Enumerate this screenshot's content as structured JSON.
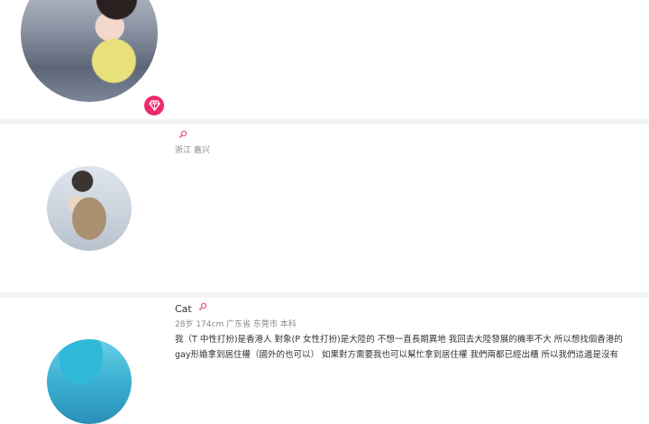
{
  "users": [
    {
      "name": "",
      "gender_icon": "female-icon",
      "badge_icon": "diamond-icon",
      "accent": "#ee2a6a"
    },
    {
      "name": "",
      "gender_icon": "female-icon",
      "location": "浙江 嘉兴"
    },
    {
      "name": "Cat",
      "gender_icon": "female-icon",
      "meta": "28岁 174cm 广东省 东莞市 本科",
      "bio_line1": "我（T 中性打扮)是香港人 對象(P 女性打扮)是大陸的 不想一直長期異地 我回去大陸發展的機率不大 所以想找個香港的",
      "bio_line2": "gay形婚拿到居住權（國外的也可以） 如果對方需要我也可以幫忙拿到居住權 我們兩都已經出櫃 所以我們這邊是沒有"
    }
  ]
}
